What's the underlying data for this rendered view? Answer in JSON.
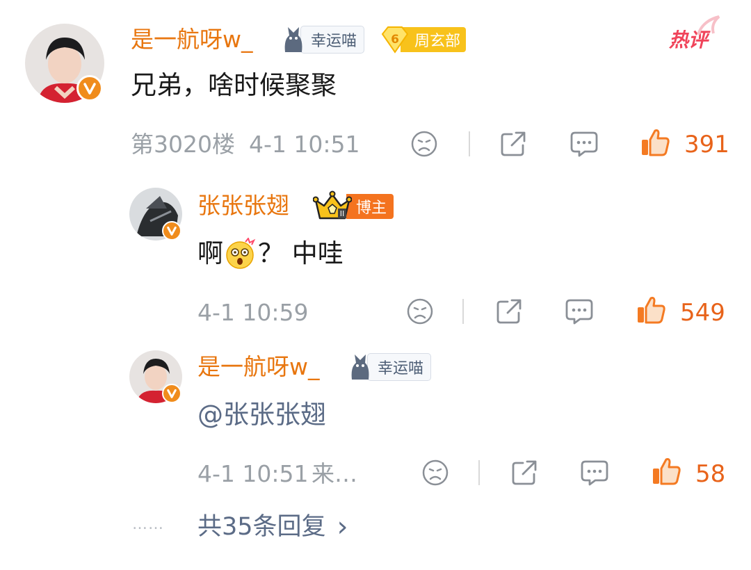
{
  "comment": {
    "user": "是一航呀w_",
    "tag_lucky": "幸运喵",
    "tag_level_num": "6",
    "tag_level_text": "周玄部",
    "hot_label": "热评",
    "text": "兄弟，啥时候聚聚",
    "floor": "第3020楼",
    "time": "4-1 10:51",
    "likes": "391"
  },
  "reply1": {
    "user": "张张张翅",
    "tag_crown": "博主",
    "text_a": "啊",
    "text_b": "？ 中哇",
    "time": "4-1 10:59",
    "likes": "549"
  },
  "reply2": {
    "user": "是一航呀w_",
    "tag_lucky": "幸运喵",
    "text": "@张张张翅",
    "time": "4-1 10:51",
    "source": "来…",
    "likes": "58"
  },
  "more": {
    "dots": "……",
    "label": "共35条回复",
    "arrow": "›"
  },
  "colors": {
    "orange": "#e8760f",
    "like": "#e8631a",
    "grey": "#9aa0a6",
    "hot": "#f0445a"
  }
}
